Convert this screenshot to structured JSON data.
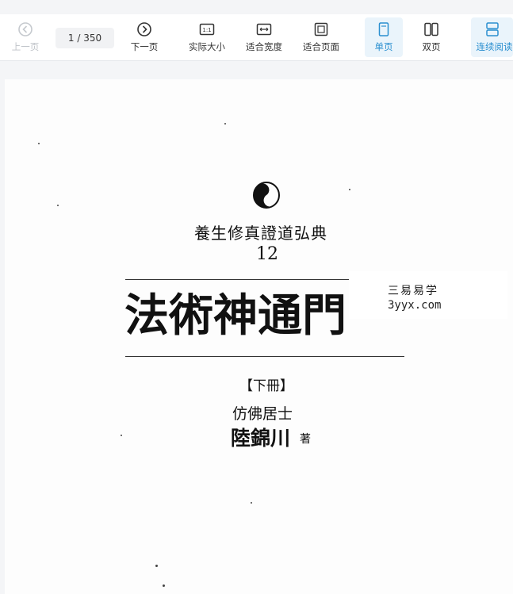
{
  "toolbar": {
    "prev_label": "上一页",
    "page_indicator": "1  / 350",
    "next_label": "下一页",
    "actual_size_label": "实际大小",
    "actual_size_icon_text": "1:1",
    "fit_width_label": "适合宽度",
    "fit_page_label": "适合页面",
    "single_page_label": "单页",
    "double_page_label": "双页",
    "continuous_label": "连续阅读"
  },
  "document": {
    "series": "養生修真證道弘典",
    "volume_number": "12",
    "title": "法術神通門",
    "volume": "【下冊】",
    "author_alias": "仿佛居士",
    "author": "陸錦川",
    "author_suffix": "著"
  },
  "watermark": {
    "line1": "三易易学",
    "line2": "3yyx.com"
  },
  "colors": {
    "accent": "#2a8fd0",
    "active_bg": "#eaf4fb",
    "disabled": "#bfc3c8"
  }
}
